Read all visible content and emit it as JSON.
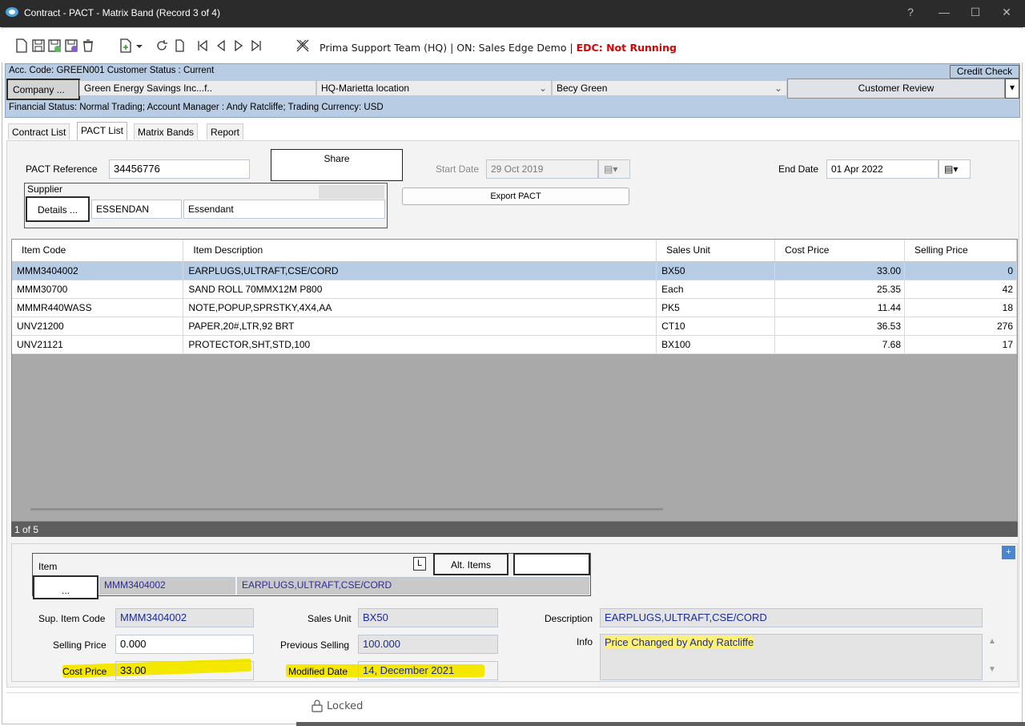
{
  "window": {
    "title": "Contract - PACT - Matrix Band  (Record 3 of 4)",
    "controls": [
      "?",
      "—",
      "☐",
      "✕"
    ]
  },
  "toolbar": {
    "info_prefix": "Prima Support Team (HQ) | ON: Sales Edge Demo | ",
    "info_status": "EDC: Not Running",
    "status_color": "#e00000"
  },
  "account": {
    "line1": "Acc. Code: GREEN001  Customer Status : Current",
    "credit_check": "Credit Check",
    "company_button": "Company ...",
    "company_name": "Green Energy Savings Inc...f..",
    "location": "HQ-Marietta location",
    "contact": "Becy Green",
    "review_button": "Customer Review",
    "line3": "Financial Status: Normal Trading;  Account Manager : Andy Ratcliffe;  Trading Currency: USD"
  },
  "tabs": [
    "Contract List",
    "PACT List",
    "Matrix Bands",
    "Report"
  ],
  "pact": {
    "ref_label": "PACT Reference",
    "ref_value": "34456776",
    "share_button": "Share",
    "start_label": "Start Date",
    "start_value": "29 Oct 2019",
    "end_label": "End Date",
    "end_value": "01 Apr 2022",
    "supplier_label": "Supplier",
    "details_button": "Details ...",
    "supplier_code": "ESSENDAN",
    "supplier_name": "Essendant",
    "export_button": "Export PACT"
  },
  "grid": {
    "columns": [
      "Item Code",
      "Item Description",
      "Sales Unit",
      "Cost Price",
      "Selling Price"
    ],
    "rows": [
      [
        "MMM3404002",
        "EARPLUGS,ULTRAFT,CSE/CORD",
        "BX50",
        "33.00",
        "0"
      ],
      [
        "MMM30700",
        "SAND ROLL 70MMX12M P800",
        "Each",
        "25.35",
        "42"
      ],
      [
        "MMMR440WASS",
        "NOTE,POPUP,SPRSTKY,4X4,AA",
        "PK5",
        "11.44",
        "18"
      ],
      [
        "UNV21200",
        "PAPER,20#,LTR,92 BRT",
        "CT10",
        "36.53",
        "276"
      ],
      [
        "UNV21121",
        "PROTECTOR,SHT,STD,100",
        "BX100",
        "7.68",
        "17"
      ]
    ],
    "status": "1 of 5"
  },
  "detail": {
    "item_label": "Item",
    "l_button": "L",
    "alt_items_button": "Alt. Items",
    "ellipsis_button": "...",
    "item_code": "MMM3404002",
    "item_desc": "EARPLUGS,ULTRAFT,CSE/CORD",
    "sup_item_code_label": "Sup. Item Code",
    "sup_item_code": "MMM3404002",
    "sales_unit_label": "Sales Unit",
    "sales_unit": "BX50",
    "description_label": "Description",
    "description": "EARPLUGS,ULTRAFT,CSE/CORD",
    "selling_price_label": "Selling Price",
    "selling_price": "0.000",
    "previous_selling_label": "Previous Selling",
    "previous_selling": "100.000",
    "info_label": "Info",
    "info": "Price Changed by Andy Ratcliffe",
    "cost_price_label": "Cost Price",
    "cost_price": "33.00",
    "modified_date_label": "Modified Date",
    "modified_date": "14, December 2021",
    "plus": "+"
  },
  "footer": {
    "locked": "Locked"
  }
}
